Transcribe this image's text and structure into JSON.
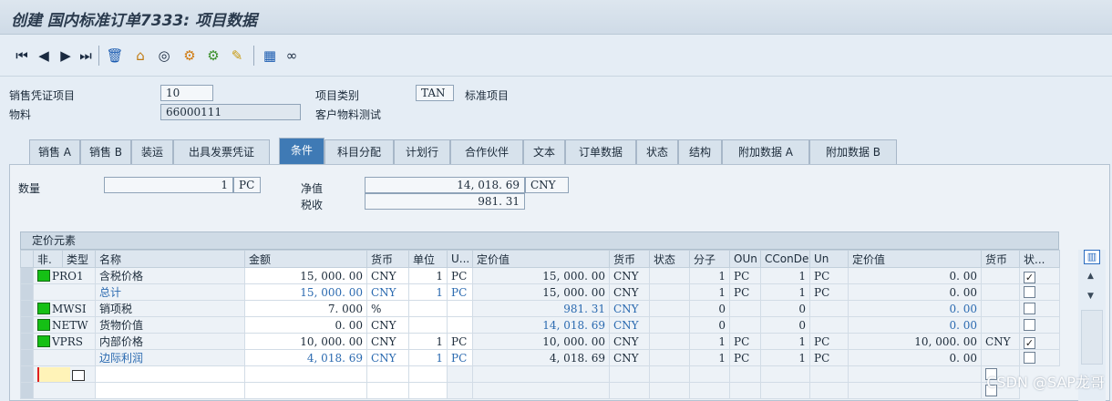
{
  "window": {
    "title": "创建 国内标准订单7333: 项目数据"
  },
  "toolbar": {
    "icons": [
      "first-icon",
      "prev-icon",
      "next-icon",
      "last-icon",
      "delete-icon",
      "up-icon",
      "overview-icon",
      "config-icon",
      "configure2-icon",
      "edit-icon",
      "calculator-icon",
      "glasses-icon"
    ]
  },
  "header": {
    "item_label": "销售凭证项目",
    "item_value": "10",
    "category_label": "项目类别",
    "category_value": "TAN",
    "category_desc": "标准项目",
    "material_label": "物料",
    "material_value": "66000111",
    "material_desc": "客户物料测试"
  },
  "tabs": [
    "销售 A",
    "销售 B",
    "装运",
    "出具发票凭证",
    "条件",
    "科目分配",
    "计划行",
    "合作伙伴",
    "文本",
    "订单数据",
    "状态",
    "结构",
    "附加数据 A",
    "附加数据 B"
  ],
  "active_tab": "条件",
  "summary": {
    "qty_label": "数量",
    "qty_value": "1",
    "qty_unit": "PC",
    "net_label": "净值",
    "net_value": "14, 018. 69",
    "net_curr": "CNY",
    "tax_label": "税收",
    "tax_value": "981. 31"
  },
  "pricing": {
    "title": "定价元素",
    "columns": [
      "非.",
      "类型",
      "名称",
      "金额",
      "货币",
      "单位",
      "U...",
      "定价值",
      "货币",
      "状态",
      "分子",
      "OUn",
      "CConDe",
      "Un",
      "定价值",
      "货币",
      "状..."
    ],
    "rows": [
      {
        "light": true,
        "type": "PRO1",
        "name": "含税价格",
        "amount": "15, 000. 00",
        "curr": "CNY",
        "unit": "1",
        "u": "PC",
        "value": "15, 000. 00",
        "vcurr": "CNY",
        "status": "",
        "num": "1",
        "oun": "PC",
        "ccon": "1",
        "un": "PC",
        "value2": "0. 00",
        "curr2": "",
        "checked": true,
        "style": "normal"
      },
      {
        "light": false,
        "type": "",
        "name": "总计",
        "amount": "15, 000. 00",
        "curr": "CNY",
        "unit": "1",
        "u": "PC",
        "value": "15, 000. 00",
        "vcurr": "CNY",
        "status": "",
        "num": "1",
        "oun": "PC",
        "ccon": "1",
        "un": "PC",
        "value2": "0. 00",
        "curr2": "",
        "checked": false,
        "style": "blue"
      },
      {
        "light": true,
        "type": "MWSI",
        "name": "销项税",
        "amount": "7. 000",
        "curr": "%",
        "unit": "",
        "u": "",
        "value": "981. 31",
        "vcurr": "CNY",
        "status": "",
        "num": "0",
        "oun": "",
        "ccon": "0",
        "un": "",
        "value2": "0. 00",
        "curr2": "",
        "checked": false,
        "style": "normal"
      },
      {
        "light": true,
        "type": "NETW",
        "name": "货物价值",
        "amount": "0. 00",
        "curr": "CNY",
        "unit": "",
        "u": "",
        "value": "14, 018. 69",
        "vcurr": "CNY",
        "status": "",
        "num": "0",
        "oun": "",
        "ccon": "0",
        "un": "",
        "value2": "0. 00",
        "curr2": "",
        "checked": false,
        "style": "normal"
      },
      {
        "light": true,
        "type": "VPRS",
        "name": "内部价格",
        "amount": "10, 000. 00",
        "curr": "CNY",
        "unit": "1",
        "u": "PC",
        "value": "10, 000. 00",
        "vcurr": "CNY",
        "status": "",
        "num": "1",
        "oun": "PC",
        "ccon": "1",
        "un": "PC",
        "value2": "10, 000. 00",
        "curr2": "CNY",
        "checked": true,
        "style": "normal"
      },
      {
        "light": false,
        "type": "",
        "name": "边际利润",
        "amount": "4, 018. 69",
        "curr": "CNY",
        "unit": "1",
        "u": "PC",
        "value": "4, 018. 69",
        "vcurr": "CNY",
        "status": "",
        "num": "1",
        "oun": "PC",
        "ccon": "1",
        "un": "PC",
        "value2": "0. 00",
        "curr2": "",
        "checked": false,
        "style": "blue"
      }
    ]
  },
  "watermark": "CSDN @SAP龙哥"
}
